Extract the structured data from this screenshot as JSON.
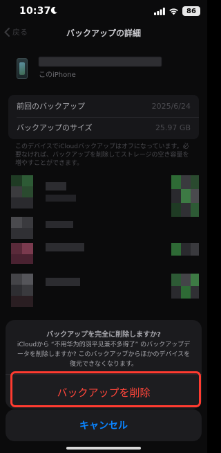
{
  "status_bar": {
    "time": "10:37",
    "battery": "86",
    "icons": [
      "moon-icon",
      "signal-icon",
      "wifi-icon",
      "battery-icon"
    ]
  },
  "nav": {
    "back_label": "戻る",
    "title": "バックアップの詳細"
  },
  "device": {
    "subtitle": "このiPhone"
  },
  "info": {
    "rows": [
      {
        "label": "前回のバックアップ",
        "value": "2025/6/24"
      },
      {
        "label": "バックアップのサイズ",
        "value": "25.97 GB"
      }
    ]
  },
  "note": "このデバイスでiCloudバックアップはオフになっています。必要なければ、バックアップを削除してストレージの空き容量を増やすことができます。",
  "sheet": {
    "title": "バックアップを完全に削除しますか?",
    "message": "iCloudから “不用华为的羽平见兼不多得了” のバックアップデータを削除しますか? このバックアップからほかのデバイスを復元できなくなります。",
    "delete_label": "バックアップを削除",
    "cancel_label": "キャンセル"
  },
  "colors": {
    "destructive": "#ff453a",
    "accent": "#0a84ff",
    "highlight": "#ff3b30"
  }
}
